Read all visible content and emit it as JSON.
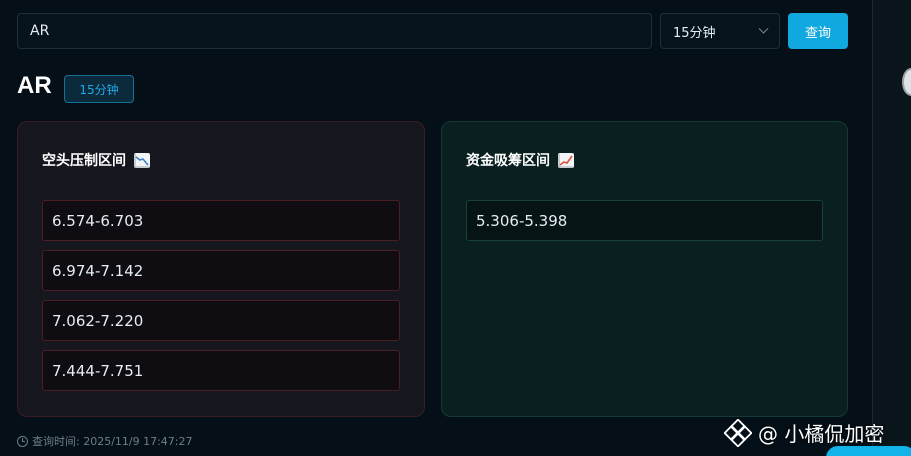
{
  "search": {
    "value": "AR",
    "interval_value": "15分钟",
    "query_label": "查询"
  },
  "header": {
    "symbol": "AR",
    "interval_badge": "15分钟"
  },
  "short_panel": {
    "title": "空头压制区间",
    "icon": "chart-decreasing-icon",
    "ranges": [
      "6.574-6.703",
      "6.974-7.142",
      "7.062-7.220",
      "7.444-7.751"
    ],
    "border_color": "#4a1e22"
  },
  "long_panel": {
    "title": "资金吸筹区间",
    "icon": "chart-increasing-icon",
    "ranges": [
      "5.306-5.398"
    ],
    "border_color": "#17403a"
  },
  "footer": {
    "query_time": "查询时间: 2025/11/9 17:47:27"
  },
  "watermark": {
    "text": "@ 小橘侃加密"
  },
  "colors": {
    "accent": "#11a8df",
    "background": "#050f17"
  }
}
